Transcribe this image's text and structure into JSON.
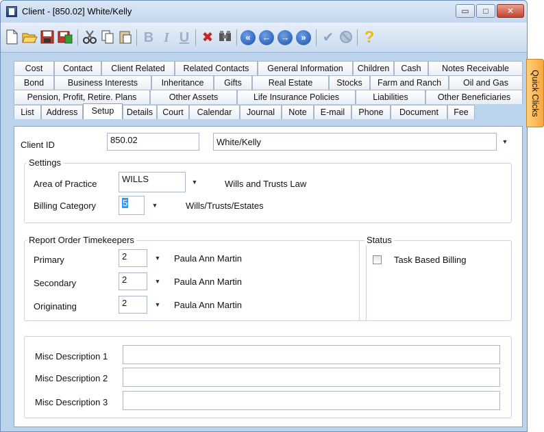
{
  "window": {
    "title": "Client - [850.02] White/Kelly",
    "controls": {
      "minimize": "▭",
      "maximize": "□",
      "close": "✕"
    }
  },
  "toolbar": {
    "icons": [
      "new-icon",
      "open-folder-icon",
      "save-icon",
      "save-close-icon",
      "cut-icon",
      "copy-icon",
      "paste-icon",
      "bold-icon",
      "italic-icon",
      "underline-icon",
      "delete-icon",
      "find-icon",
      "first-record-icon",
      "previous-record-icon",
      "next-record-icon",
      "last-record-icon",
      "check-icon",
      "cancel-icon",
      "help-icon"
    ],
    "bold": "B",
    "italic": "I",
    "underline": "U",
    "help": "?"
  },
  "tabs": {
    "row1": [
      "Cost",
      "Contact",
      "Client Related",
      "Related Contacts",
      "General Information",
      "Children",
      "Cash",
      "Notes Receivable"
    ],
    "row2": [
      "Bond",
      "Business Interests",
      "Inheritance",
      "Gifts",
      "Real Estate",
      "Stocks",
      "Farm and Ranch",
      "Oil and Gas"
    ],
    "row3": [
      "Pension, Profit, Retire. Plans",
      "Other Assets",
      "Life Insurance Policies",
      "Liabilities",
      "Other Beneficiaries"
    ],
    "row4": [
      "List",
      "Address",
      "Setup",
      "Details",
      "Court",
      "Calendar",
      "Journal",
      "Note",
      "E-mail",
      "Phone",
      "Document",
      "Fee"
    ],
    "active": "Setup"
  },
  "quick_clicks": "Quick Clicks",
  "client": {
    "id_label": "Client ID",
    "id_value": "850.02",
    "name_value": "White/Kelly"
  },
  "settings": {
    "title": "Settings",
    "area_label": "Area of Practice",
    "area_value": "WILLS",
    "area_desc": "Wills and Trusts Law",
    "billing_label": "Billing Category",
    "billing_value": "5",
    "billing_desc": "Wills/Trusts/Estates"
  },
  "timekeepers": {
    "title": "Report Order Timekeepers",
    "primary_label": "Primary",
    "primary_value": "2",
    "primary_name": "Paula Ann Martin",
    "secondary_label": "Secondary",
    "secondary_value": "2",
    "secondary_name": "Paula Ann Martin",
    "originating_label": "Originating",
    "originating_value": "2",
    "originating_name": "Paula Ann Martin"
  },
  "status": {
    "title": "Status",
    "task_based_label": "Task Based Billing",
    "task_based_checked": false
  },
  "misc": {
    "label1": "Misc Description 1",
    "value1": "",
    "label2": "Misc Description 2",
    "value2": "",
    "label3": "Misc Description 3",
    "value3": ""
  },
  "colors": {
    "accent": "#3399ff",
    "quick_clicks": "#f7a73e",
    "window_frame": "#bcd3ec"
  }
}
